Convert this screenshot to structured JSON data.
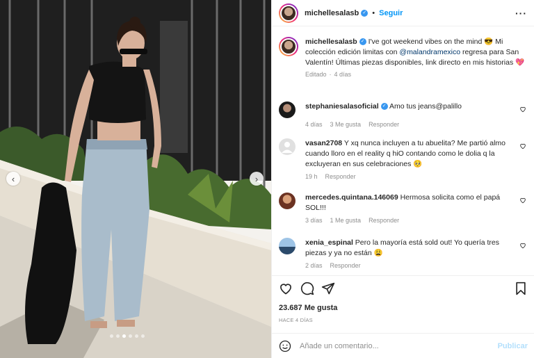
{
  "post": {
    "username": "michellesalasb",
    "follow_label": "Seguir",
    "dot": "•",
    "more_label": "···"
  },
  "caption": {
    "username": "michellesalasb",
    "text_before": " I've got weekend vibes on the mind 😎 Mi colección edición limitas con ",
    "mention": "@malandramexico",
    "text_after": " regresa para San Valentín! Últimas piezas disponibles, link directo en mis historias 💖",
    "edited": "Editado",
    "time": "4 días"
  },
  "comments": [
    {
      "username": "stephaniesalasoficial",
      "verified": true,
      "text": " Amo tus jeans@palillo",
      "time": "4 días",
      "likes": "3 Me gusta",
      "reply": "Responder"
    },
    {
      "username": "vasan2708",
      "verified": false,
      "text": " Y xq nunca incluyen a tu abuelita? Me partió almo cuando lloro en el reality q hiO contando como le dolia q la excluyeran en sus celebraciones 🥺",
      "time": "19 h",
      "likes": "",
      "reply": "Responder"
    },
    {
      "username": "mercedes.quintana.146069",
      "verified": false,
      "text": " Hermosa solicita como el papá SOL!!!",
      "time": "3 días",
      "likes": "1 Me gusta",
      "reply": "Responder"
    },
    {
      "username": "xenia_espinal",
      "verified": false,
      "text": " Pero la mayoría está sold out! Yo quería tres piezas y ya no están 😩",
      "time": "2 días",
      "likes": "",
      "reply": "Responder"
    }
  ],
  "stats": {
    "likes": "23.687 Me gusta",
    "ago": "HACE 4 DÍAS"
  },
  "composer": {
    "placeholder": "Añade un comentario...",
    "publish_label": "Publicar"
  },
  "carousel": {
    "prev": "‹",
    "next": "›",
    "slide_count": 6,
    "active_index": 2
  }
}
